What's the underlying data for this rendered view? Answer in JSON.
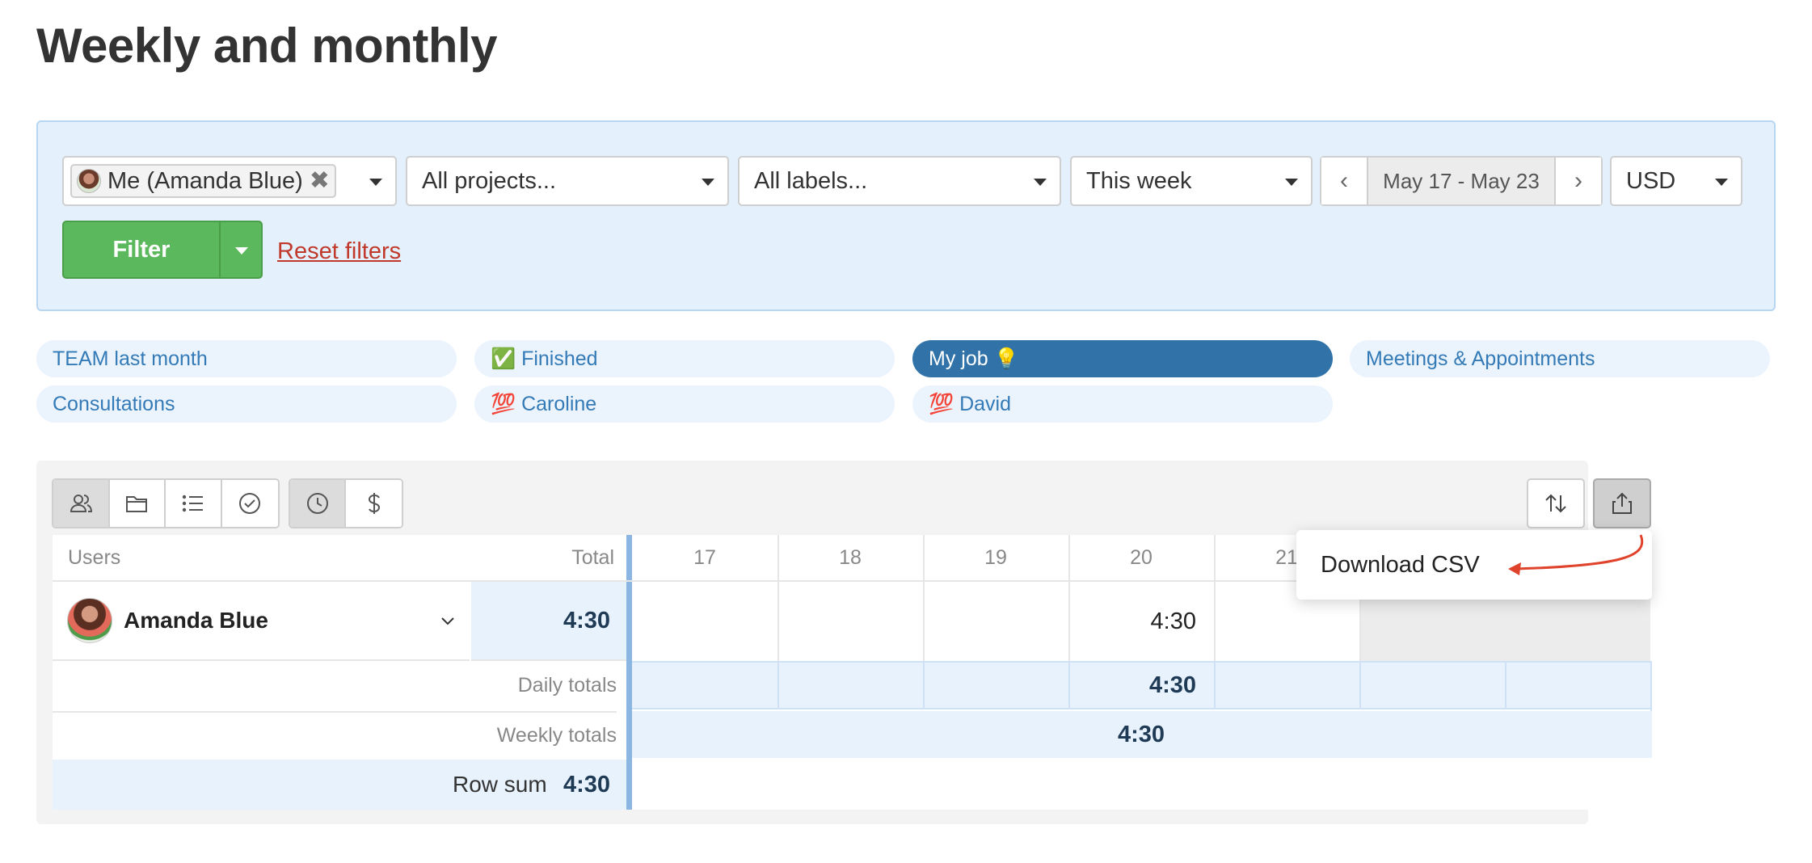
{
  "page": {
    "title": "Weekly and monthly"
  },
  "filters": {
    "user_tag": "Me (Amanda Blue)",
    "tag_remove": "✖",
    "projects": "All projects...",
    "labels": "All labels...",
    "period": "This week",
    "date_prev": "‹",
    "date_range": "May 17 - May 23",
    "date_next": "›",
    "currency": "USD",
    "filter_button": "Filter",
    "reset_link": "Reset filters"
  },
  "saved_filters": [
    {
      "label": "TEAM last month",
      "active": false
    },
    {
      "label": "✅ Finished",
      "active": false
    },
    {
      "label": "My job 💡",
      "active": true
    },
    {
      "label": "Meetings & Appointments",
      "active": false
    },
    {
      "label": "Consultations",
      "active": false
    },
    {
      "label": "💯 Caroline",
      "active": false
    },
    {
      "label": "💯 David",
      "active": false
    }
  ],
  "toolbar": {
    "group_icons": [
      "users-icon",
      "folder-icon",
      "list-icon",
      "check-circle-icon"
    ],
    "mode_icons": [
      "clock-icon",
      "dollar-icon"
    ],
    "sort_icon": "sort-arrows-icon",
    "export_icon": "share-export-icon"
  },
  "table": {
    "col_users": "Users",
    "col_total": "Total",
    "days": [
      "17",
      "18",
      "19",
      "20",
      "21"
    ],
    "rows": [
      {
        "name": "Amanda Blue",
        "total": "4:30",
        "day_values": [
          "",
          "",
          "",
          "4:30",
          ""
        ]
      }
    ],
    "daily_totals_label": "Daily totals",
    "daily_totals": [
      "",
      "",
      "",
      "4:30",
      "",
      "",
      ""
    ],
    "weekly_totals_label": "Weekly totals",
    "weekly_total": "4:30",
    "row_sum_label": "Row sum",
    "row_sum_value": "4:30"
  },
  "export_menu": {
    "download_csv": "Download CSV"
  },
  "colors": {
    "accent": "#337ab7",
    "active_pill": "#3173a8",
    "filter_green": "#5cb85c",
    "reset_red": "#c0392b",
    "annotation_arrow": "#e0432b"
  }
}
